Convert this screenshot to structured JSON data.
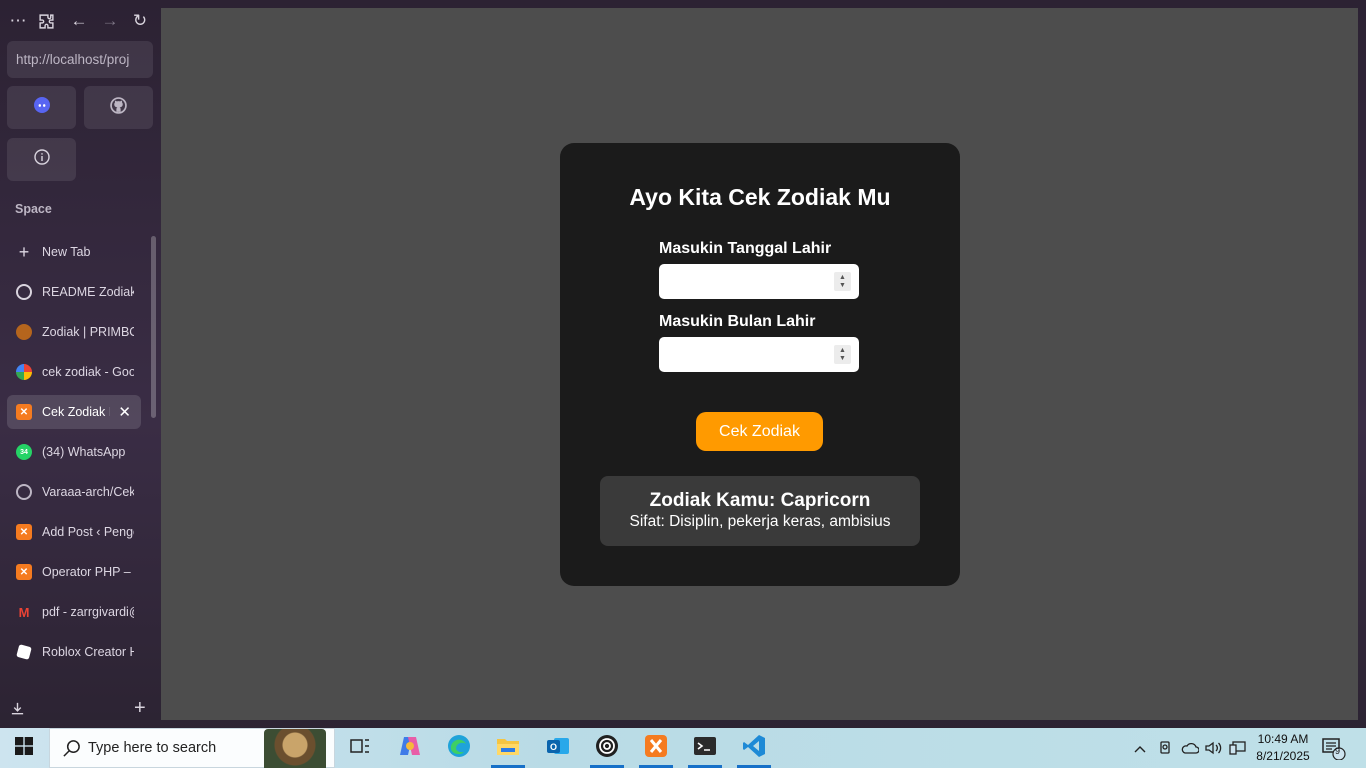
{
  "browser": {
    "url": "http://localhost/proj",
    "space_label": "Space",
    "new_tab_label": "New Tab",
    "pinned": [
      "discord-icon",
      "github-icon",
      "info-icon"
    ],
    "tabs": [
      {
        "title": "README Zodiak I",
        "icon": "openai-icon",
        "color": "#2a2a2a"
      },
      {
        "title": "Zodiak | PRIMBON",
        "icon": "primbon-icon",
        "color": "#b5651d"
      },
      {
        "title": "cek zodiak - Goog",
        "icon": "google-icon",
        "color": "#ffffff"
      },
      {
        "title": "Cek Zodiak I",
        "icon": "xampp-icon",
        "color": "#f57b20",
        "active": true
      },
      {
        "title": "(34) WhatsApp",
        "icon": "whatsapp-icon",
        "color": "#25d366",
        "badge": "34"
      },
      {
        "title": "Varaaa-arch/Cek-",
        "icon": "github-icon",
        "color": "#2a2a2a"
      },
      {
        "title": "Add Post ‹ Penge",
        "icon": "xampp-icon",
        "color": "#f57b20"
      },
      {
        "title": "Operator PHP – F",
        "icon": "xampp-icon",
        "color": "#f57b20"
      },
      {
        "title": "pdf - zarrgivardi@",
        "icon": "gmail-icon",
        "color": "#ffffff"
      },
      {
        "title": "Roblox Creator H",
        "icon": "roblox-icon",
        "color": "#ffffff"
      }
    ]
  },
  "app": {
    "title": "Ayo Kita Cek Zodiak Mu",
    "day_label": "Masukin Tanggal Lahir",
    "day_value": "",
    "month_label": "Masukin Bulan Lahir",
    "month_value": "",
    "button_label": "Cek Zodiak",
    "result_title": "Zodiak Kamu: Capricorn",
    "result_desc": "Sifat: Disiplin, pekerja keras, ambisius",
    "accent": "#ff9a00"
  },
  "taskbar": {
    "search_placeholder": "Type here to search",
    "time": "10:49 AM",
    "date": "8/21/2025",
    "notification_count": "9"
  }
}
